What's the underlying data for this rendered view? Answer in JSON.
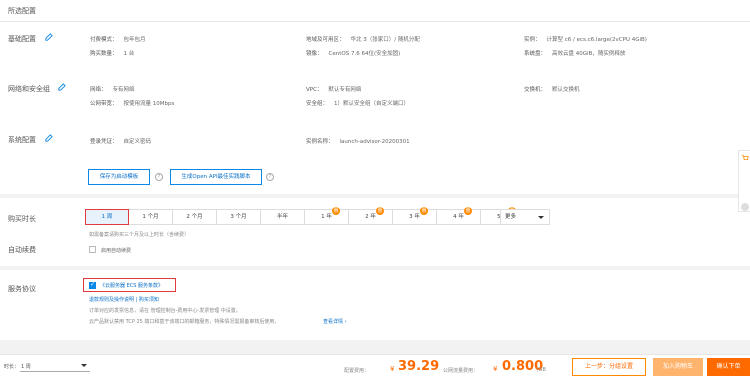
{
  "header": {
    "title": "所选配置"
  },
  "basic": {
    "label": "基础配置",
    "billing_label": "付费模式：",
    "billing": "包年包月",
    "count_label": "购买数量：",
    "count": "1 台",
    "region_label": "地域及可用区：",
    "region": "华北 3（张家口）/ 随机分配",
    "image_label": "镜像：",
    "image": "CentOS 7.6 64位(安全加固)",
    "instance_label": "实例：",
    "instance": "计算型 c6 / ecs.c6.large(2vCPU 4GiB)",
    "disk_label": "系统盘：",
    "disk": "高效云盘 40GiB，随实例释放"
  },
  "network": {
    "label": "网络和安全组",
    "net_label": "网络：",
    "net": "专有网络",
    "bw_label": "公网带宽：",
    "bw": "按使用流量 10Mbps",
    "vpc_label": "VPC：",
    "vpc": "默认专有网络",
    "sg_label": "安全组：",
    "sg": "1）默认安全组（自定义端口）",
    "switch_label": "交换机：",
    "switch": "默认交换机"
  },
  "system": {
    "label": "系统配置",
    "login_label": "登录凭证：",
    "login": "自定义密码",
    "name_label": "实例名称：",
    "name": "launch-advisor-20200301"
  },
  "actions": {
    "save_template": "保存为启动模板",
    "gen_api": "生成Open API最佳实践脚本"
  },
  "duration": {
    "label": "购买时长",
    "options": [
      "1 周",
      "1 个月",
      "2 个月",
      "3 个月",
      "半年",
      "1 年",
      "2 年",
      "3 年",
      "4 年",
      "5 年"
    ],
    "more": "更多",
    "hint": "如需备案请购买三个月及以上时长（含续费）"
  },
  "renew": {
    "label": "自动续费",
    "option": "启用自动续费"
  },
  "agreement": {
    "label": "服务协议",
    "terms": "《云服务器 ECS 服务条款》",
    "links": "退款规则及操作说明 | 购买须知",
    "note1": "订单对应的发票信息，请在 管理控制台-费用中心-发票管理 中设置。",
    "note1_link": "发票管理",
    "note2": "云产品默认禁用 TCP 25 端口和基于该端口的邮箱服务，特殊情况需报备审核后使用，",
    "note2_link": "查看详情 ›"
  },
  "footer": {
    "duration_label": "时长：",
    "duration": "1 周",
    "price_label": "配置费用：",
    "price_symbol": "¥",
    "price": "39.29",
    "traffic_label": "公网流量费用：",
    "traffic_symbol": "¥",
    "traffic": "0.800",
    "traffic_unit": "/GB",
    "prev": "上一步：分组设置",
    "cart": "加入购物车",
    "buy": "确认下单"
  }
}
